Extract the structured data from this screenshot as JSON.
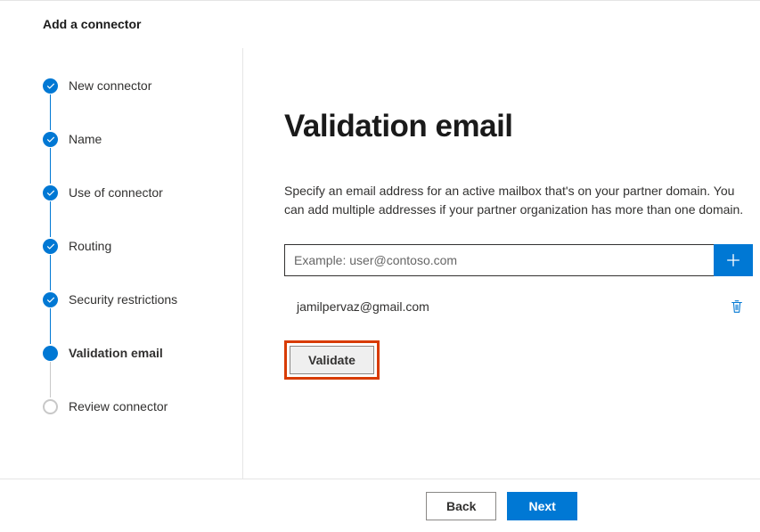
{
  "header": {
    "title": "Add a connector"
  },
  "steps": [
    {
      "label": "New connector",
      "state": "completed"
    },
    {
      "label": "Name",
      "state": "completed"
    },
    {
      "label": "Use of connector",
      "state": "completed"
    },
    {
      "label": "Routing",
      "state": "completed"
    },
    {
      "label": "Security restrictions",
      "state": "completed"
    },
    {
      "label": "Validation email",
      "state": "current"
    },
    {
      "label": "Review connector",
      "state": "pending"
    }
  ],
  "main": {
    "heading": "Validation email",
    "instructions": "Specify an email address for an active mailbox that's on your partner domain. You can add multiple addresses if your partner organization has more than one domain.",
    "email_placeholder": "Example: user@contoso.com",
    "emails": [
      "jamilpervaz@gmail.com"
    ],
    "validate_label": "Validate"
  },
  "footer": {
    "back_label": "Back",
    "next_label": "Next"
  },
  "colors": {
    "primary": "#0078d4",
    "highlight": "#d83b01"
  }
}
